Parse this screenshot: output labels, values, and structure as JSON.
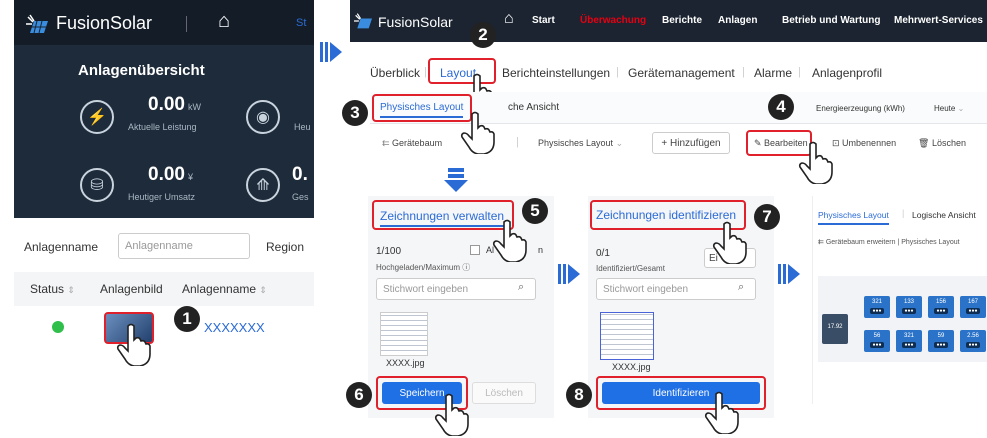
{
  "left": {
    "brand": "FusionSolar",
    "nav_partial": "St",
    "overview_title": "Anlagenübersicht",
    "stats": [
      {
        "value": "0.00",
        "unit": "kW",
        "label": "Aktuelle Leistung"
      },
      {
        "value": "0.00",
        "unit": "¥",
        "label": "Heutiger Umsatz"
      }
    ],
    "stats_partial": [
      {
        "value": "",
        "label": "Heu"
      },
      {
        "value": "0.",
        "label": "Ges"
      }
    ],
    "filter_label": "Anlagenname",
    "filter_placeholder": "Anlagenname",
    "region_label": "Region",
    "columns": [
      "Status",
      "Anlagenbild",
      "Anlagenname"
    ],
    "row_name": "XXXXXXX"
  },
  "header": {
    "brand": "FusionSolar",
    "nav": [
      "Start",
      "Überwachung",
      "Berichte",
      "Anlagen",
      "Betrieb und Wartung",
      "Mehrwert-Services"
    ]
  },
  "tabs": [
    "Überblick",
    "Layout",
    "Berichteinstellungen",
    "Gerätemanagement",
    "Alarme",
    "Anlagenprofil"
  ],
  "subtabs": {
    "physical": "Physisches Layout",
    "logical_partial": "che Ansicht"
  },
  "energy": {
    "label": "Energieerzeugung (kWh)",
    "period": "Heute"
  },
  "toolbar": {
    "device_tree": "Gerätebaum",
    "layout_select": "Physisches Layout",
    "add": "+ Hinzufügen",
    "edit": "Bearbeiten",
    "rename": "Umbenennen",
    "delete": "Löschen"
  },
  "manage": {
    "title": "Zeichnungen verwalten",
    "count": "1/100",
    "count_label": "Hochgeladen/Maximum",
    "checkbox_partial": "Al",
    "checkbox_partial2": "n",
    "search_placeholder": "Stichwort eingeben",
    "file": "XXXX.jpg",
    "save": "Speichern",
    "delete": "Löschen"
  },
  "identify": {
    "title": "Zeichnungen identifizieren",
    "count": "0/1",
    "count_label": "Identifiziert/Gesamt",
    "btn_partial": "Ei",
    "search_placeholder": "Stichwort eingeben",
    "file": "XXXX.jpg",
    "identify_btn": "Identifizieren"
  },
  "result": {
    "tab_physical": "Physisches Layout",
    "tab_logical": "Logische Ansicht",
    "tree_link": "Gerätebaum erweitern",
    "layout_sel": "Physisches Layout",
    "tiles_top": [
      "321",
      "133",
      "156",
      "167"
    ],
    "tiles_bottom": [
      "56",
      "321",
      "59",
      "2.56"
    ],
    "side_value": "17.92"
  },
  "badges": [
    "1",
    "2",
    "3",
    "4",
    "5",
    "6",
    "7",
    "8"
  ]
}
